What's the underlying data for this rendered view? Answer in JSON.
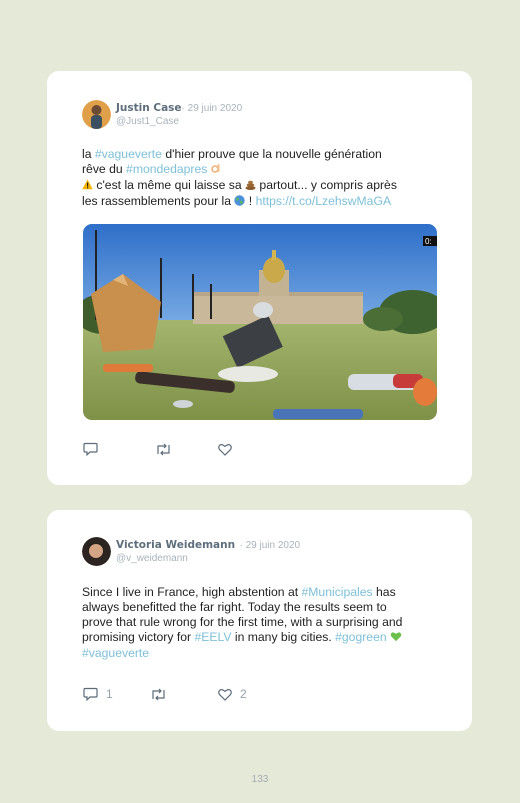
{
  "tweets": [
    {
      "name": "Justin Case",
      "date": "· 29 juin 2020",
      "handle": "@Just1_Case",
      "line1_prefix": "la ",
      "line1_hash": "#vagueverte",
      "line1_suffix": " d'hier prouve que la nouvelle génération",
      "line2_prefix": "rêve du ",
      "line2_hash": "#mondedapres",
      "line3_text": " c'est la même qui laisse sa ",
      "line3_suffix": " partout... y compris après",
      "line4_text": "les rassemblements pour la ",
      "line4_mid": " ! ",
      "link": "https://t.co/LzehswMaGA",
      "media_badge": "0:",
      "replies": "",
      "retweets": "",
      "likes": "",
      "icons": [
        "ok-hand-emoji",
        "warning-emoji",
        "poop-emoji",
        "earth-emoji"
      ]
    },
    {
      "name": "Victoria Weidemann",
      "date": "· 29 juin 2020",
      "handle": "@v_weidemann",
      "l1_prefix": "Since I live in France, high abstention at ",
      "l1_hash": "#Municipales",
      "l1_suffix": " has",
      "l2": "always benefitted the far right. Today the results seem to",
      "l3": "prove that rule wrong for the first time, with a surprising and",
      "l4_prefix": "promising victory for ",
      "l4_hash": "#EELV",
      "l4_mid": " in many big cities. ",
      "l4_hash2": "#gogreen",
      "l5_hash": "#vagueverte",
      "replies": "1",
      "retweets": "",
      "likes": "2",
      "icons": [
        "green-heart-emoji"
      ]
    }
  ],
  "page_number": "133",
  "colors": {
    "background": "#e5ead8",
    "hashtag": "#7ec0d8",
    "name": "#5e6e7c"
  }
}
